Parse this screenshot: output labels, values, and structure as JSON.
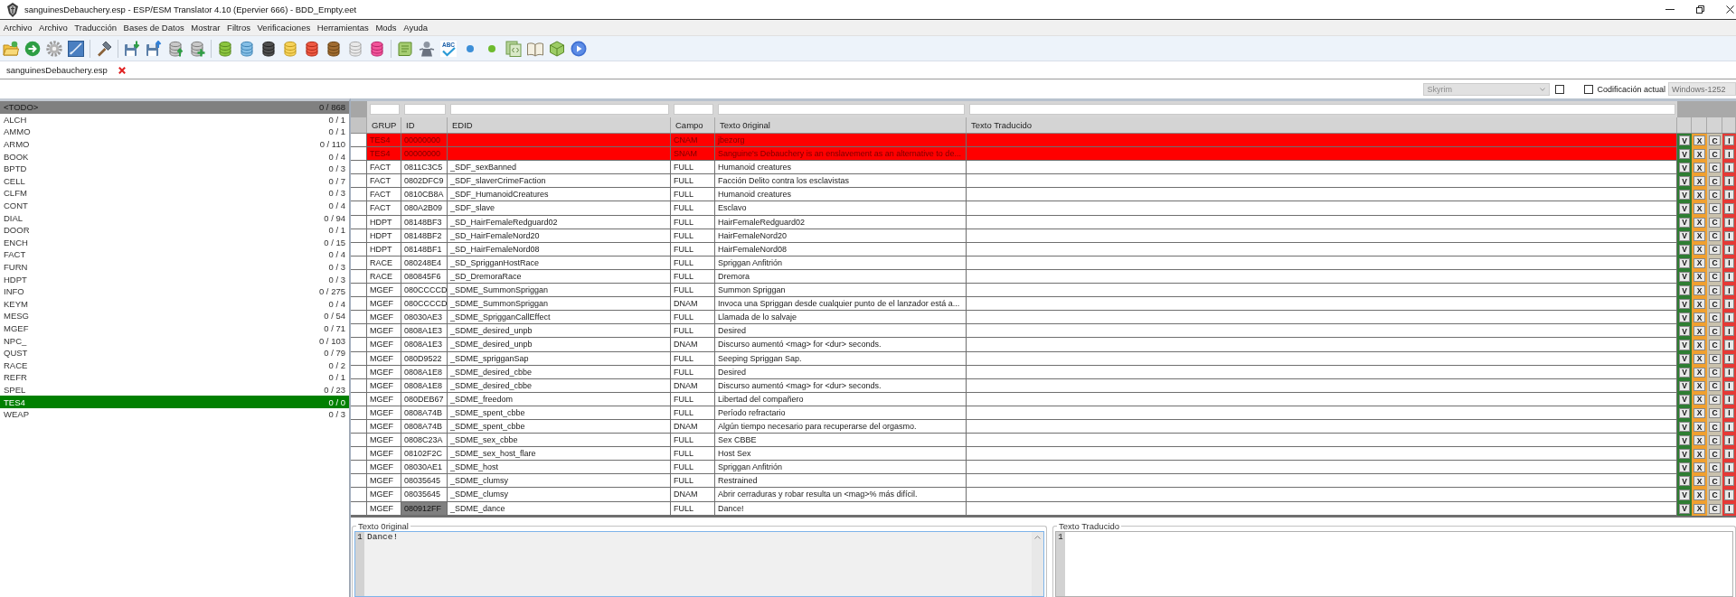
{
  "window": {
    "title": "sanguinesDebauchery.esp - ESP/ESM Translator 4.10 (Epervier 666) - BDD_Empty.eet"
  },
  "menu": [
    "Archivo",
    "Archivo",
    "Traducción",
    "Bases de Datos",
    "Mostrar",
    "Filtros",
    "Verificaciones",
    "Herramientas",
    "Mods",
    "Ayuda"
  ],
  "toolbar": {
    "spellcheck_label": "ABC"
  },
  "tabs": [
    {
      "label": "sanguinesDebauchery.esp",
      "selected": true
    }
  ],
  "options": {
    "game": {
      "value": "Skyrim",
      "disabled": true
    },
    "game_toggle": {
      "checked": false
    },
    "encoding": {
      "label": "Codificación actual",
      "checked": false,
      "value": "Windows-1252",
      "disabled": true
    }
  },
  "sidebar": {
    "items": [
      {
        "label": "<TODO>",
        "count": "0 / 868",
        "selected": true,
        "complete": false
      },
      {
        "label": "ALCH",
        "count": "0 / 1",
        "selected": false,
        "complete": false
      },
      {
        "label": "AMMO",
        "count": "0 / 1",
        "selected": false,
        "complete": false
      },
      {
        "label": "ARMO",
        "count": "0 / 110",
        "selected": false,
        "complete": false
      },
      {
        "label": "BOOK",
        "count": "0 / 4",
        "selected": false,
        "complete": false
      },
      {
        "label": "BPTD",
        "count": "0 / 3",
        "selected": false,
        "complete": false
      },
      {
        "label": "CELL",
        "count": "0 / 7",
        "selected": false,
        "complete": false
      },
      {
        "label": "CLFM",
        "count": "0 / 3",
        "selected": false,
        "complete": false
      },
      {
        "label": "CONT",
        "count": "0 / 4",
        "selected": false,
        "complete": false
      },
      {
        "label": "DIAL",
        "count": "0 / 94",
        "selected": false,
        "complete": false
      },
      {
        "label": "DOOR",
        "count": "0 / 1",
        "selected": false,
        "complete": false
      },
      {
        "label": "ENCH",
        "count": "0 / 15",
        "selected": false,
        "complete": false
      },
      {
        "label": "FACT",
        "count": "0 / 4",
        "selected": false,
        "complete": false
      },
      {
        "label": "FURN",
        "count": "0 / 3",
        "selected": false,
        "complete": false
      },
      {
        "label": "HDPT",
        "count": "0 / 3",
        "selected": false,
        "complete": false
      },
      {
        "label": "INFO",
        "count": "0 / 275",
        "selected": false,
        "complete": false
      },
      {
        "label": "KEYM",
        "count": "0 / 4",
        "selected": false,
        "complete": false
      },
      {
        "label": "MESG",
        "count": "0 / 54",
        "selected": false,
        "complete": false
      },
      {
        "label": "MGEF",
        "count": "0 / 71",
        "selected": false,
        "complete": false
      },
      {
        "label": "NPC_",
        "count": "0 / 103",
        "selected": false,
        "complete": false
      },
      {
        "label": "QUST",
        "count": "0 / 79",
        "selected": false,
        "complete": false
      },
      {
        "label": "RACE",
        "count": "0 / 2",
        "selected": false,
        "complete": false
      },
      {
        "label": "REFR",
        "count": "0 / 1",
        "selected": false,
        "complete": false
      },
      {
        "label": "SPEL",
        "count": "0 / 23",
        "selected": false,
        "complete": false
      },
      {
        "label": "TES4",
        "count": "0 / 0",
        "selected": false,
        "complete": true
      },
      {
        "label": "WEAP",
        "count": "0 / 3",
        "selected": false,
        "complete": false
      }
    ]
  },
  "table": {
    "columns": [
      "GRUP",
      "ID",
      "EDID",
      "Campo",
      "Texto 0riginal",
      "Texto Traducido"
    ],
    "action_columns": [
      {
        "color": "#2e7d32"
      },
      {
        "color": "#f0a030"
      },
      {
        "color": "#c9c1ad"
      },
      {
        "color": "#e53935"
      }
    ],
    "rows": [
      {
        "grup": "TES4",
        "id": "00000000",
        "campo": "CNAM",
        "texto_original": "jbezorg",
        "error": true,
        "selected": false,
        "actions": [
          "V",
          "X",
          "C",
          "I"
        ]
      },
      {
        "grup": "TES4",
        "id": "00000000",
        "campo": "SNAM",
        "texto_original": "Sanguine's Debauchery is an enslavement as an alternative to de...",
        "error": true,
        "selected": false,
        "actions": [
          "V",
          "X",
          "C",
          "I"
        ]
      },
      {
        "grup": "FACT",
        "id": "0811C3C5",
        "edid": "_SDF_sexBanned",
        "campo": "FULL",
        "texto_original": "Humanoid creatures",
        "error": false,
        "selected": false,
        "actions": [
          "V",
          "X",
          "C",
          "I"
        ]
      },
      {
        "grup": "FACT",
        "id": "0802DFC9",
        "edid": "_SDF_slaverCrimeFaction",
        "campo": "FULL",
        "texto_original": "Facción Delito contra los esclavistas",
        "error": false,
        "selected": false,
        "actions": [
          "V",
          "X",
          "C",
          "I"
        ]
      },
      {
        "grup": "FACT",
        "id": "0810CB8A",
        "edid": "_SDF_HumanoidCreatures",
        "campo": "FULL",
        "texto_original": "Humanoid creatures",
        "error": false,
        "selected": false,
        "actions": [
          "V",
          "X",
          "C",
          "I"
        ]
      },
      {
        "grup": "FACT",
        "id": "080A2B09",
        "edid": "_SDF_slave",
        "campo": "FULL",
        "texto_original": "Esclavo",
        "error": false,
        "selected": false,
        "actions": [
          "V",
          "X",
          "C",
          "I"
        ]
      },
      {
        "grup": "HDPT",
        "id": "08148BF3",
        "edid": "_SD_HairFemaleRedguard02",
        "campo": "FULL",
        "texto_original": "HairFemaleRedguard02",
        "error": false,
        "selected": false,
        "actions": [
          "V",
          "X",
          "C",
          "I"
        ]
      },
      {
        "grup": "HDPT",
        "id": "08148BF2",
        "edid": "_SD_HairFemaleNord20",
        "campo": "FULL",
        "texto_original": "HairFemaleNord20",
        "error": false,
        "selected": false,
        "actions": [
          "V",
          "X",
          "C",
          "I"
        ]
      },
      {
        "grup": "HDPT",
        "id": "08148BF1",
        "edid": "_SD_HairFemaleNord08",
        "campo": "FULL",
        "texto_original": "HairFemaleNord08",
        "error": false,
        "selected": false,
        "actions": [
          "V",
          "X",
          "C",
          "I"
        ]
      },
      {
        "grup": "RACE",
        "id": "080248E4",
        "edid": "_SD_SprigganHostRace",
        "campo": "FULL",
        "texto_original": "Spriggan Anfitrión",
        "error": false,
        "selected": false,
        "actions": [
          "V",
          "X",
          "C",
          "I"
        ]
      },
      {
        "grup": "RACE",
        "id": "080845F6",
        "edid": "_SD_DremoraRace",
        "campo": "FULL",
        "texto_original": "Dremora",
        "error": false,
        "selected": false,
        "actions": [
          "V",
          "X",
          "C",
          "I"
        ]
      },
      {
        "grup": "MGEF",
        "id": "080CCCCD",
        "edid": "_SDME_SummonSpriggan",
        "campo": "FULL",
        "texto_original": "Summon Spriggan",
        "error": false,
        "selected": false,
        "actions": [
          "V",
          "X",
          "C",
          "I"
        ]
      },
      {
        "grup": "MGEF",
        "id": "080CCCCD",
        "edid": "_SDME_SummonSpriggan",
        "campo": "DNAM",
        "texto_original": "Invoca una Spriggan desde cualquier punto de el lanzador está a...",
        "error": false,
        "selected": false,
        "actions": [
          "V",
          "X",
          "C",
          "I"
        ]
      },
      {
        "grup": "MGEF",
        "id": "08030AE3",
        "edid": "_SDME_SprigganCallEffect",
        "campo": "FULL",
        "texto_original": "Llamada de lo salvaje",
        "error": false,
        "selected": false,
        "actions": [
          "V",
          "X",
          "C",
          "I"
        ]
      },
      {
        "grup": "MGEF",
        "id": "0808A1E3",
        "edid": "_SDME_desired_unpb",
        "campo": "FULL",
        "texto_original": "Desired",
        "error": false,
        "selected": false,
        "actions": [
          "V",
          "X",
          "C",
          "I"
        ]
      },
      {
        "grup": "MGEF",
        "id": "0808A1E3",
        "edid": "_SDME_desired_unpb",
        "campo": "DNAM",
        "texto_original": "Discurso aumentó <mag> for <dur> seconds.",
        "error": false,
        "selected": false,
        "actions": [
          "V",
          "X",
          "C",
          "I"
        ]
      },
      {
        "grup": "MGEF",
        "id": "080D9522",
        "edid": "_SDME_sprigganSap",
        "campo": "FULL",
        "texto_original": "Seeping Spriggan Sap.",
        "error": false,
        "selected": false,
        "actions": [
          "V",
          "X",
          "C",
          "I"
        ]
      },
      {
        "grup": "MGEF",
        "id": "0808A1E8",
        "edid": "_SDME_desired_cbbe",
        "campo": "FULL",
        "texto_original": "Desired",
        "error": false,
        "selected": false,
        "actions": [
          "V",
          "X",
          "C",
          "I"
        ]
      },
      {
        "grup": "MGEF",
        "id": "0808A1E8",
        "edid": "_SDME_desired_cbbe",
        "campo": "DNAM",
        "texto_original": "Discurso aumentó <mag> for <dur> seconds.",
        "error": false,
        "selected": false,
        "actions": [
          "V",
          "X",
          "C",
          "I"
        ]
      },
      {
        "grup": "MGEF",
        "id": "080DEB67",
        "edid": "_SDME_freedom",
        "campo": "FULL",
        "texto_original": "Libertad del compañero",
        "error": false,
        "selected": false,
        "actions": [
          "V",
          "X",
          "C",
          "I"
        ]
      },
      {
        "grup": "MGEF",
        "id": "0808A74B",
        "edid": "_SDME_spent_cbbe",
        "campo": "FULL",
        "texto_original": "Período refractario",
        "error": false,
        "selected": false,
        "actions": [
          "V",
          "X",
          "C",
          "I"
        ]
      },
      {
        "grup": "MGEF",
        "id": "0808A74B",
        "edid": "_SDME_spent_cbbe",
        "campo": "DNAM",
        "texto_original": "Algún tiempo necesario para recuperarse del orgasmo.",
        "error": false,
        "selected": false,
        "actions": [
          "V",
          "X",
          "C",
          "I"
        ]
      },
      {
        "grup": "MGEF",
        "id": "0808C23A",
        "edid": "_SDME_sex_cbbe",
        "campo": "FULL",
        "texto_original": "Sex CBBE",
        "error": false,
        "selected": false,
        "actions": [
          "V",
          "X",
          "C",
          "I"
        ]
      },
      {
        "grup": "MGEF",
        "id": "08102F2C",
        "edid": "_SDME_sex_host_flare",
        "campo": "FULL",
        "texto_original": "Host Sex",
        "error": false,
        "selected": false,
        "actions": [
          "V",
          "X",
          "C",
          "I"
        ]
      },
      {
        "grup": "MGEF",
        "id": "08030AE1",
        "edid": "_SDME_host",
        "campo": "FULL",
        "texto_original": "Spriggan Anfitrión",
        "error": false,
        "selected": false,
        "actions": [
          "V",
          "X",
          "C",
          "I"
        ]
      },
      {
        "grup": "MGEF",
        "id": "08035645",
        "edid": "_SDME_clumsy",
        "campo": "FULL",
        "texto_original": "Restrained",
        "error": false,
        "selected": false,
        "actions": [
          "V",
          "X",
          "C",
          "I"
        ]
      },
      {
        "grup": "MGEF",
        "id": "08035645",
        "edid": "_SDME_clumsy",
        "campo": "DNAM",
        "texto_original": "Abrir cerraduras y robar resulta un <mag>% más difícil.",
        "error": false,
        "selected": false,
        "actions": [
          "V",
          "X",
          "C",
          "I"
        ]
      },
      {
        "grup": "MGEF",
        "id": "080912FF",
        "edid": "_SDME_dance",
        "campo": "FULL",
        "texto_original": "Dance!",
        "error": false,
        "selected": true,
        "actions": [
          "V",
          "X",
          "C",
          "I"
        ]
      }
    ]
  },
  "editors": [
    {
      "title": "Texto 0riginal",
      "line_numbers": [
        "1"
      ],
      "lines": [
        "Dance!"
      ],
      "read_only": true,
      "focused": true
    },
    {
      "title": "Texto Traducido",
      "line_numbers": [
        "1"
      ],
      "read_only": false,
      "focused": false
    }
  ]
}
